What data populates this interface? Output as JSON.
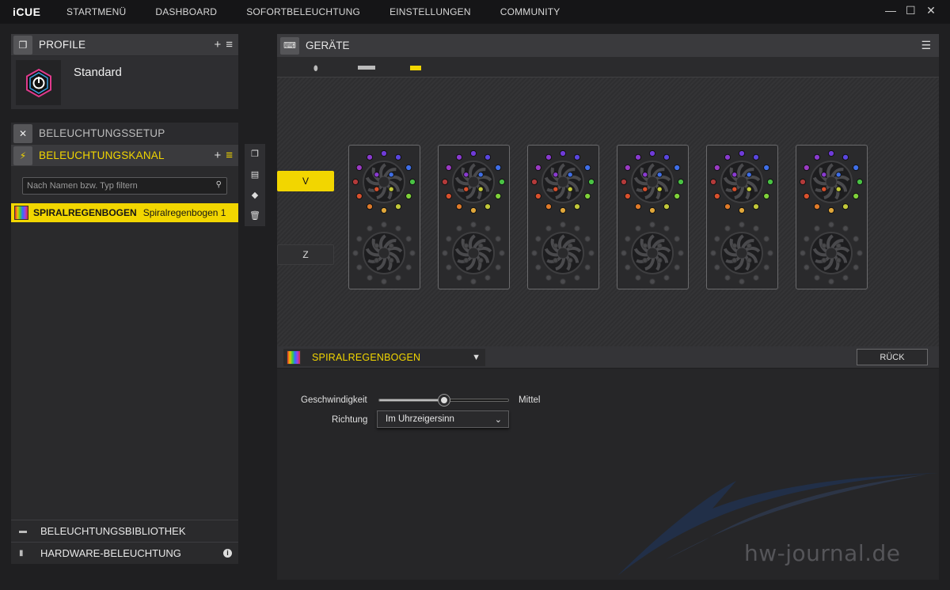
{
  "app": {
    "logo": "iCUE"
  },
  "nav": [
    "STARTMENÜ",
    "DASHBOARD",
    "SOFORTBELEUCHTUNG",
    "EINSTELLUNGEN",
    "COMMUNITY"
  ],
  "window_controls": {
    "minimize": "—",
    "maximize": "☐",
    "close": "✕"
  },
  "profile": {
    "title": "PROFILE",
    "name": "Standard"
  },
  "lighting_setup": {
    "title": "BELEUCHTUNGSSETUP"
  },
  "lighting_channel": {
    "title": "BELEUCHTUNGSKANAL",
    "filter_placeholder": "Nach Namen bzw. Typ filtern",
    "selected_effect_type": "SPIRALREGENBOGEN",
    "selected_effect_name": "Spiralregenbogen 1"
  },
  "library": {
    "label": "BELEUCHTUNGSBIBLIOTHEK"
  },
  "hardware": {
    "label": "HARDWARE-BELEUCHTUNG"
  },
  "devices": {
    "title": "GERÄTE"
  },
  "zones": {
    "front": "V",
    "back": "Z"
  },
  "effect": {
    "name": "SPIRALREGENBOGEN",
    "back_button": "RÜCK",
    "speed_label": "Geschwindigkeit",
    "speed_value": "Mittel",
    "speed_fraction": 0.5,
    "direction_label": "Richtung",
    "direction_value": "Im Uhrzeigersinn"
  },
  "fan_count": 6,
  "led_colors": [
    "#6f3bd8",
    "#5a46e0",
    "#3f6fe8",
    "#49c244",
    "#7fd23a",
    "#c2c83a",
    "#e0a63a",
    "#e07b2a",
    "#d8502d",
    "#b33a3a",
    "#9b3bc4",
    "#8a3bd0"
  ],
  "watermark": "hw-journal.de",
  "accent_color": "#f2d600"
}
